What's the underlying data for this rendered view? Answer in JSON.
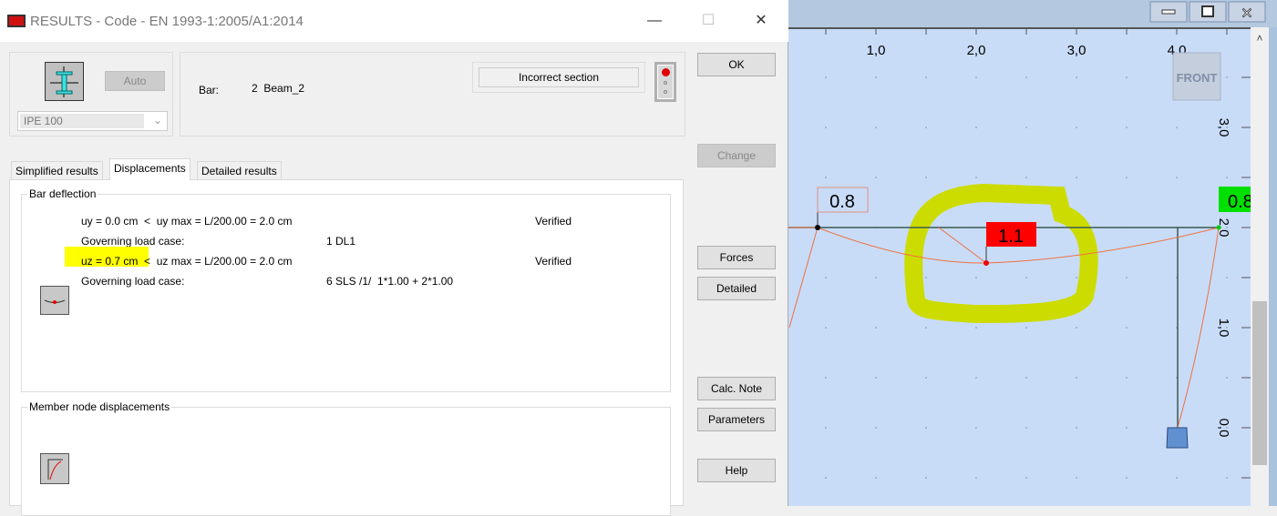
{
  "dialog": {
    "title": "RESULTS - Code - EN 1993-1:2005/A1:2014",
    "section": {
      "auto_label": "Auto",
      "profile": "IPE 100"
    },
    "bar": {
      "label": "Bar:",
      "value": "2  Beam_2"
    },
    "status": {
      "text": "Incorrect section",
      "light_color": "#e00000"
    },
    "buttons": {
      "ok": "OK",
      "change": "Change",
      "forces": "Forces",
      "detailed": "Detailed",
      "calc_note": "Calc. Note",
      "parameters": "Parameters",
      "help": "Help"
    },
    "tabs": [
      {
        "label": "Simplified results"
      },
      {
        "label": "Displacements",
        "active": true
      },
      {
        "label": "Detailed results"
      }
    ],
    "bar_deflection": {
      "title": "Bar deflection",
      "rows": [
        {
          "check": "uy = 0.0 cm  <  uy max = L/200.00 = 2.0 cm",
          "status": "Verified"
        },
        {
          "label": "Governing load case:",
          "value": "1 DL1"
        },
        {
          "check_hl": "uz = 0.7 cm  <",
          "check": "  uz max = L/200.00 = 2.0 cm",
          "status": "Verified"
        },
        {
          "label": "Governing load case:",
          "value": "6 SLS /1/  1*1.00 + 2*1.00"
        }
      ]
    },
    "member_node": {
      "title": "Member node displacements"
    }
  },
  "view": {
    "x_ticks": [
      "1,0",
      "2,0",
      "3,0",
      "4,0"
    ],
    "y_ticks": [
      "3,0",
      "2,0",
      "1,0",
      "0,0"
    ],
    "view_cube": "FRONT",
    "labels": {
      "left": "0.8",
      "mid": "1.1",
      "right": "0.8"
    },
    "colors": {
      "background": "#c8dcf8",
      "highlight": "#cddc00",
      "max": "#ff0000",
      "right": "#00e000"
    }
  }
}
